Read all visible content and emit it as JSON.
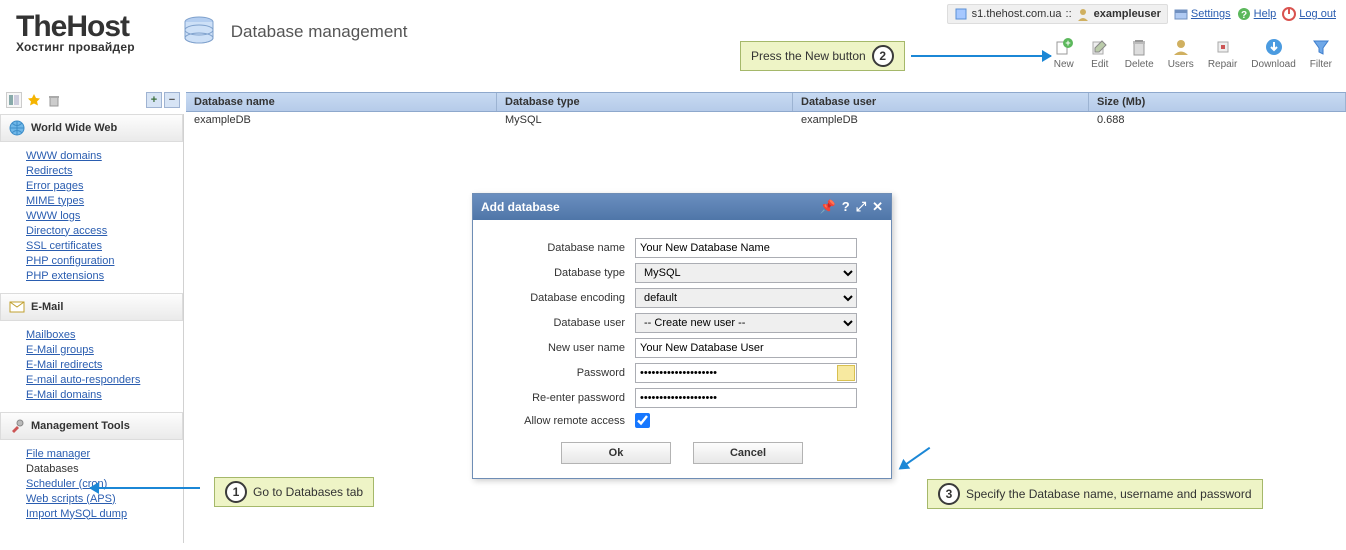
{
  "topbar": {
    "server": "s1.thehost.com.ua",
    "user": "exampleuser",
    "settings": "Settings",
    "help": "Help",
    "logout": "Log out"
  },
  "logo": {
    "line1": "TheHost",
    "line2": "Хостинг провайдер"
  },
  "page_title": "Database management",
  "callouts": {
    "c1": "Go to Databases tab",
    "c2": "Press the New button",
    "c3": "Specify the Database name, username and password"
  },
  "toolbar": [
    {
      "label": "New"
    },
    {
      "label": "Edit"
    },
    {
      "label": "Delete"
    },
    {
      "label": "Users"
    },
    {
      "label": "Repair"
    },
    {
      "label": "Download"
    },
    {
      "label": "Filter"
    }
  ],
  "sidebar": {
    "sections": [
      {
        "title": "World Wide Web",
        "links": [
          "WWW domains",
          "Redirects",
          "Error pages",
          "MIME types",
          "WWW logs",
          "Directory access",
          "SSL certificates",
          "PHP configuration",
          "PHP extensions"
        ]
      },
      {
        "title": "E-Mail",
        "links": [
          "Mailboxes",
          "E-Mail groups",
          "E-Mail redirects",
          "E-mail auto-responders",
          "E-Mail domains"
        ]
      },
      {
        "title": "Management Tools",
        "links": [
          "File manager",
          "Databases",
          "Scheduler (cron)",
          "Web scripts (APS)",
          "Import MySQL dump"
        ]
      }
    ]
  },
  "table": {
    "headers": {
      "name": "Database name",
      "type": "Database type",
      "user": "Database user",
      "size": "Size (Mb)"
    },
    "row": {
      "name": "exampleDB",
      "type": "MySQL",
      "user": "exampleDB",
      "size": "0.688"
    }
  },
  "dialog": {
    "title": "Add database",
    "labels": {
      "dbname": "Database name",
      "dbtype": "Database type",
      "encoding": "Database encoding",
      "dbuser": "Database user",
      "newuser": "New user name",
      "password": "Password",
      "repassword": "Re-enter password",
      "remote": "Allow remote access"
    },
    "values": {
      "dbname": "Your New Database Name",
      "dbtype": "MySQL",
      "encoding": "default",
      "dbuser": "-- Create new user --",
      "newuser": "Your New Database User",
      "password": "••••••••••••••••••••",
      "repassword": "••••••••••••••••••••",
      "remote": true
    },
    "buttons": {
      "ok": "Ok",
      "cancel": "Cancel"
    }
  }
}
